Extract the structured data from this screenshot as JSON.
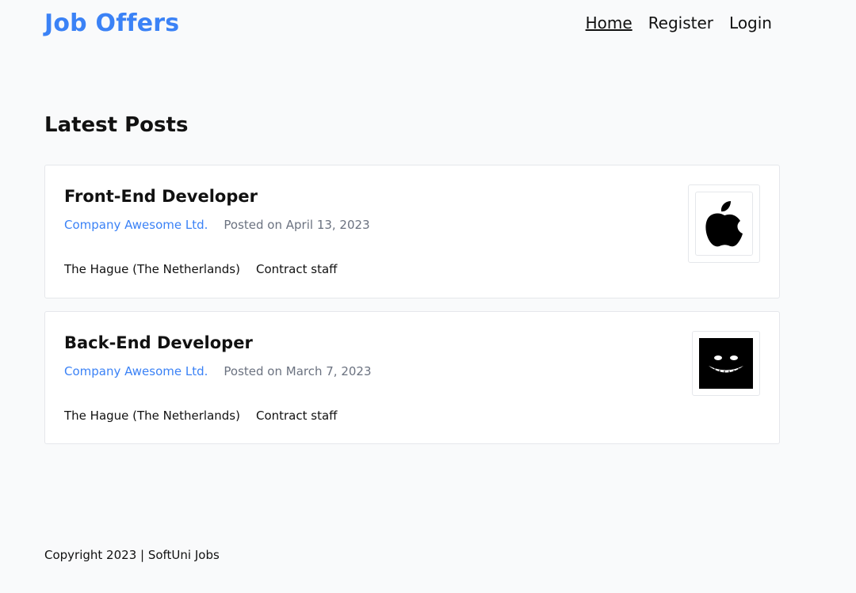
{
  "header": {
    "logo": "Job Offers",
    "nav": [
      {
        "label": "Home"
      },
      {
        "label": "Register"
      },
      {
        "label": "Login"
      }
    ]
  },
  "page": {
    "heading": "Latest Posts"
  },
  "posts": [
    {
      "title": "Front-End Developer",
      "company": "Company Awesome Ltd.",
      "posted": "Posted on April 13, 2023",
      "location": "The Hague (The Netherlands)",
      "type": "Contract staff",
      "logo_icon": "apple-logo-icon"
    },
    {
      "title": "Back-End Developer",
      "company": "Company Awesome Ltd.",
      "posted": "Posted on March 7, 2023",
      "location": "The Hague (The Netherlands)",
      "type": "Contract staff",
      "logo_icon": "grinning-face-logo-icon"
    }
  ],
  "footer": {
    "copyright": "Copyright 2023 | SoftUni Jobs"
  },
  "colors": {
    "accent": "#3b82f6",
    "background": "#f9fafb",
    "muted_text": "#6b7280"
  }
}
